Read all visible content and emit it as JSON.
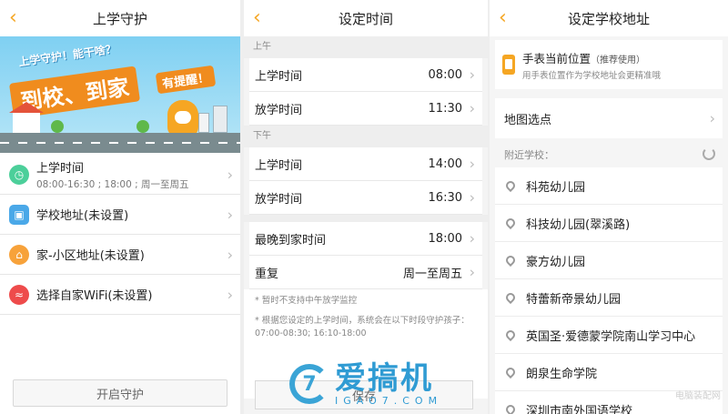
{
  "screen1": {
    "title": "上学守护",
    "banner": {
      "line1": "上学守护！能干啥？",
      "big": "到校、到家",
      "tip": "有提醒！"
    },
    "items": [
      {
        "label": "上学时间",
        "sub": "08:00-16:30 ; 18:00 ; 周一至周五",
        "icon": "clock-icon"
      },
      {
        "label": "学校地址(未设置)",
        "icon": "school-icon"
      },
      {
        "label": "家-小区地址(未设置)",
        "icon": "home-icon"
      },
      {
        "label": "选择自家WiFi(未设置)",
        "icon": "wifi-icon"
      }
    ],
    "button": "开启守护"
  },
  "screen2": {
    "title": "设定时间",
    "am_label": "上午",
    "pm_label": "下午",
    "am": [
      {
        "label": "上学时间",
        "value": "08:00"
      },
      {
        "label": "放学时间",
        "value": "11:30"
      }
    ],
    "pm": [
      {
        "label": "上学时间",
        "value": "14:00"
      },
      {
        "label": "放学时间",
        "value": "16:30"
      }
    ],
    "extra": [
      {
        "label": "最晚到家时间",
        "value": "18:00"
      },
      {
        "label": "重复",
        "value": "周一至周五"
      }
    ],
    "note1": "* 暂时不支持中午放学监控",
    "note2": "* 根据您设定的上学时间，系统会在以下时段守护孩子：07:00-08:30; 16:10-18:00",
    "button": "保存"
  },
  "screen3": {
    "title": "设定学校地址",
    "current_location": "手表当前位置",
    "recommend": "（推荐使用）",
    "current_location_sub": "用手表位置作为学校地址会更精准哦",
    "map_pick": "地图选点",
    "nearby_label": "附近学校：",
    "schools": [
      "科苑幼儿园",
      "科技幼儿园(翠溪路)",
      "豪方幼儿园",
      "特蕾新帝景幼儿园",
      "英国圣·爱德蒙学院南山学习中心",
      "朗泉生命学院",
      "深圳市南外国语学校"
    ]
  },
  "watermark": {
    "brand": "爱搞机",
    "domain": "IGAO7.COM",
    "corner": "电脑装配网"
  },
  "colors": {
    "accent": "#f5a623",
    "watermark": "#2f9bd3"
  }
}
